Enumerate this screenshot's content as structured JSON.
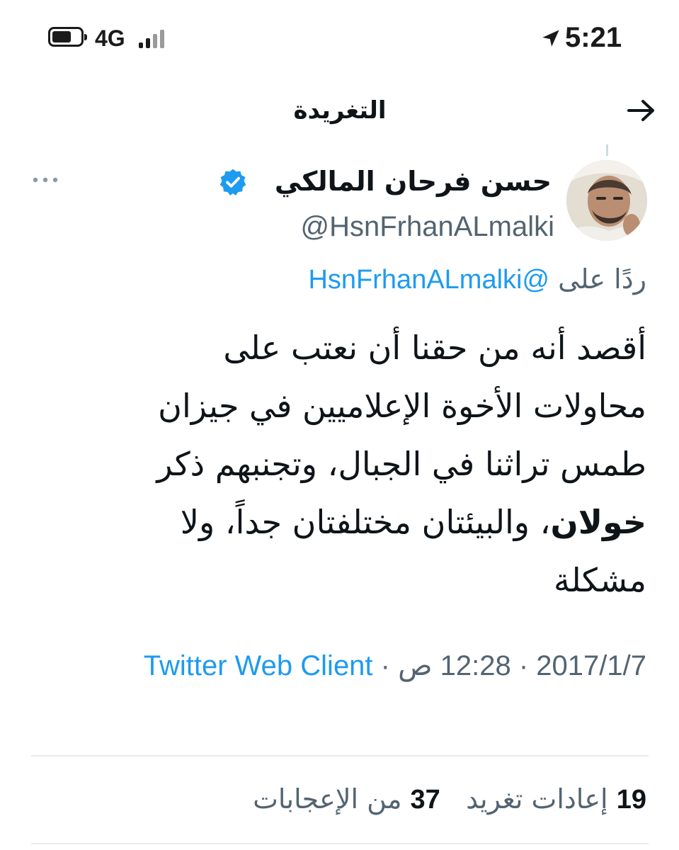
{
  "status_bar": {
    "network": "4G",
    "time": "5:21",
    "icons": [
      "battery-icon",
      "signal-icon",
      "location-icon"
    ]
  },
  "header": {
    "title": "التغريدة",
    "back_icon": "arrow-right-icon"
  },
  "tweet": {
    "author_name": "حسن فرحان المالكي",
    "handle": "@HsnFrhanALmalki",
    "verified": true,
    "reply_prefix": "ردًا على",
    "reply_to": "@HsnFrhanALmalki",
    "text_lines": [
      "أقصد أنه من حقنا أن نعتب على",
      "محاولات الأخوة الإعلاميين في جيزان",
      "طمس تراثنا في الجبال، وتجنبهم ذكر"
    ],
    "text_bold": "خولان",
    "text_after_bold": "، والبيئتان مختلفتان جداً، ولا",
    "text_last_line": "مشكلة",
    "date": "2017/1/7",
    "separator": "·",
    "time": "12:28 ص",
    "source": "Twitter Web Client"
  },
  "stats": {
    "retweets_count": "19",
    "retweets_label": "إعادات تغريد",
    "likes_count": "37",
    "likes_label": "من الإعجابات"
  },
  "colors": {
    "link": "#1d9bf0",
    "secondary_text": "#536471",
    "primary_text": "#0f1419",
    "divider": "#e6ecf0"
  }
}
